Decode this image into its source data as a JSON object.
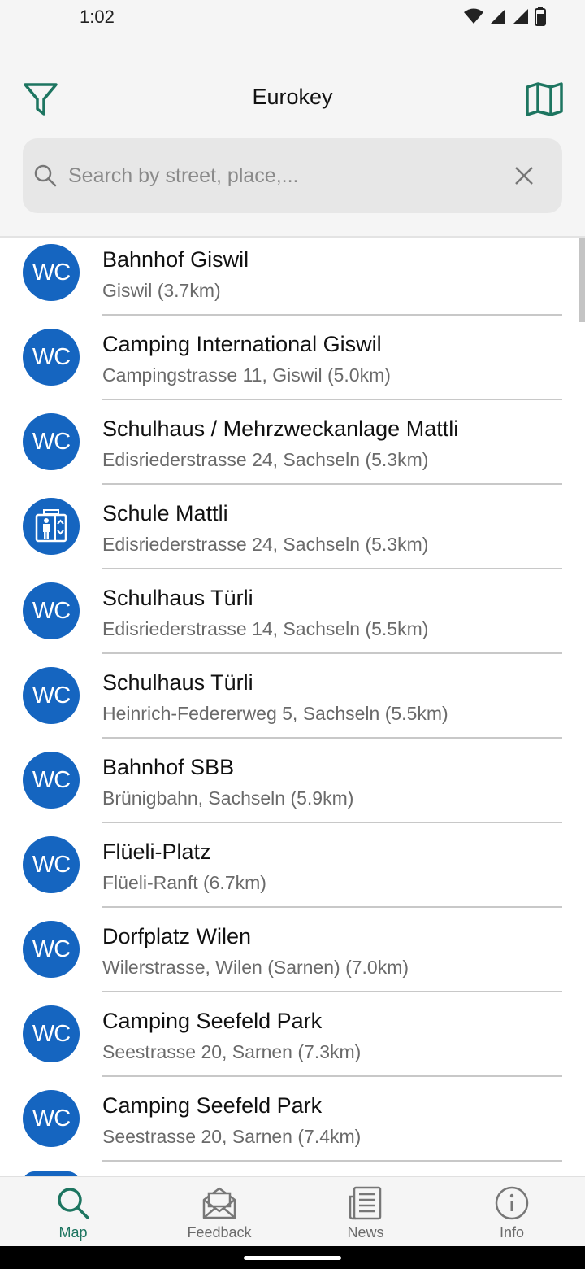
{
  "status": {
    "time": "1:02"
  },
  "header": {
    "title": "Eurokey"
  },
  "search": {
    "placeholder": "Search by street, place,..."
  },
  "colors": {
    "accent": "#1d7560",
    "icon_blue": "#1565c0"
  },
  "list": [
    {
      "icon": "WC",
      "title": "Bahnhof Giswil",
      "subtitle": "Giswil (3.7km)"
    },
    {
      "icon": "WC",
      "title": "Camping International Giswil",
      "subtitle": "Campingstrasse 11, Giswil (5.0km)"
    },
    {
      "icon": "WC",
      "title": "Schulhaus / Mehrzweckanlage Mattli",
      "subtitle": "Edisriederstrasse 24, Sachseln (5.3km)"
    },
    {
      "icon": "elevator-icon",
      "title": "Schule Mattli",
      "subtitle": "Edisriederstrasse 24, Sachseln (5.3km)"
    },
    {
      "icon": "WC",
      "title": "Schulhaus Türli",
      "subtitle": "Edisriederstrasse 14, Sachseln (5.5km)"
    },
    {
      "icon": "WC",
      "title": "Schulhaus Türli",
      "subtitle": "Heinrich-Federerweg 5, Sachseln (5.5km)"
    },
    {
      "icon": "WC",
      "title": "Bahnhof SBB",
      "subtitle": "Brünigbahn, Sachseln (5.9km)"
    },
    {
      "icon": "WC",
      "title": "Flüeli-Platz",
      "subtitle": "Flüeli-Ranft (6.7km)"
    },
    {
      "icon": "WC",
      "title": "Dorfplatz Wilen",
      "subtitle": "Wilerstrasse, Wilen (Sarnen) (7.0km)"
    },
    {
      "icon": "WC",
      "title": "Camping Seefeld Park",
      "subtitle": "Seestrasse 20, Sarnen (7.3km)"
    },
    {
      "icon": "WC",
      "title": "Camping Seefeld Park",
      "subtitle": "Seestrasse 20, Sarnen (7.4km)"
    }
  ],
  "nav": [
    {
      "label": "Map",
      "icon": "search-icon",
      "active": true
    },
    {
      "label": "Feedback",
      "icon": "feedback-icon",
      "active": false
    },
    {
      "label": "News",
      "icon": "news-icon",
      "active": false
    },
    {
      "label": "Info",
      "icon": "info-icon",
      "active": false
    }
  ]
}
